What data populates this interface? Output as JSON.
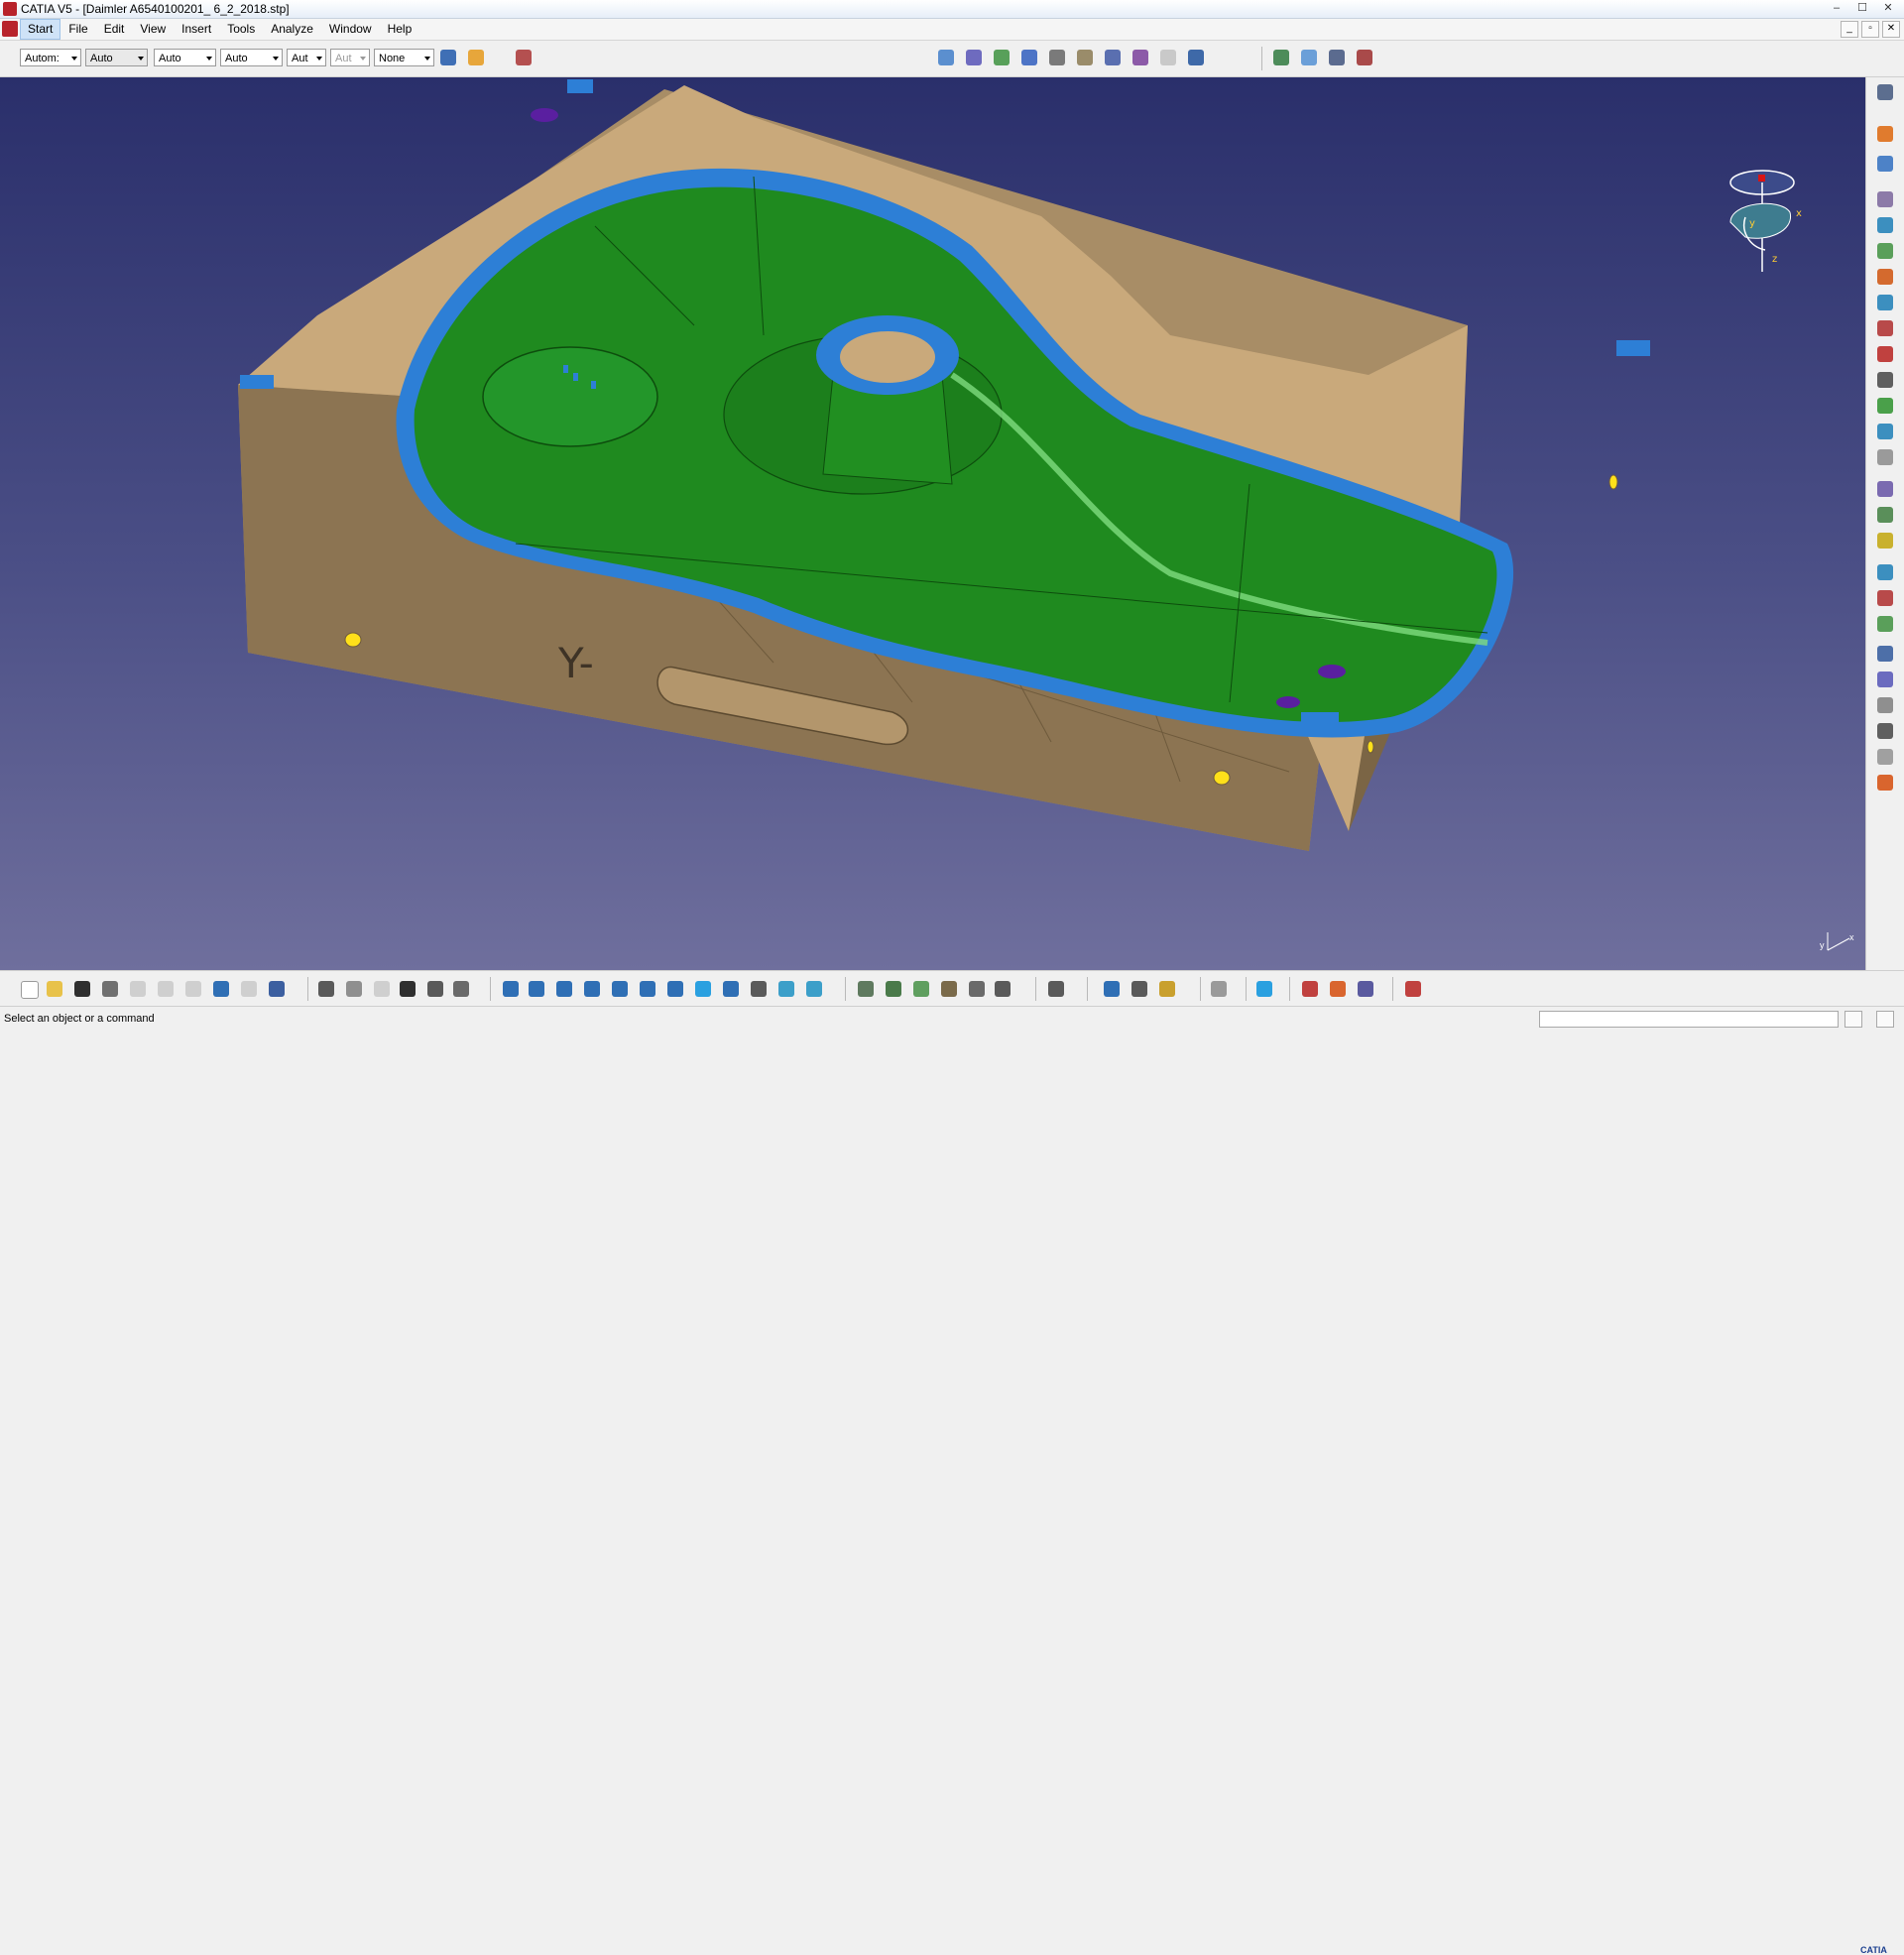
{
  "window": {
    "title": "CATIA V5 - [Daimler A6540100201_ 6_2_2018.stp]",
    "controls": [
      "–",
      "☐",
      "✕"
    ]
  },
  "menubar": {
    "items": [
      "Start",
      "File",
      "Edit",
      "View",
      "Insert",
      "Tools",
      "Analyze",
      "Window",
      "Help"
    ],
    "active": "Start",
    "mdi_controls": [
      "_",
      "▫",
      "✕"
    ]
  },
  "toolbar_top": {
    "dropdowns": [
      "Autom:",
      "Auto",
      "Auto",
      "Auto",
      "Aut",
      "Aut",
      "None"
    ],
    "disabled_dropdown_index": 5
  },
  "viewport": {
    "part_label": "Y-",
    "compass_axes": {
      "x": "x",
      "y": "y",
      "z": "z"
    },
    "corner_axes": {
      "x": "x",
      "y": "y"
    },
    "colors": {
      "background_top": "#2a2f6b",
      "background_bottom": "#6f6f9d",
      "body": "#c9a97b",
      "body_side": "#a88d66",
      "cavity": "#1f8a1f",
      "edge_strip": "#2d7fd6",
      "hole_marker": "#5a1fa0",
      "dowel_marker": "#ffe01a"
    }
  },
  "brand": {
    "logo": "CATIA"
  },
  "statusbar": {
    "message": "Select an object or a command"
  },
  "icons": {
    "top_toolbar": [
      "draw-style-icon",
      "paint-icon",
      "catalog-icon",
      "open-body-icon",
      "part-body-icon",
      "assembly-icon",
      "plane-icon",
      "constraint-icon",
      "sketch-icon",
      "feature-icon",
      "tree-icon",
      "update-icon",
      "analysis-icon",
      "view-icon",
      "render-icon",
      "layer-icon",
      "properties-icon"
    ],
    "right_toolbar": [
      "select-icon",
      "pointer-icon",
      "sketcher-icon",
      "pad-icon",
      "pocket-icon",
      "shaft-icon",
      "hole-icon",
      "rib-icon",
      "slot-icon",
      "fillet-icon",
      "chamfer-icon",
      "draft-icon",
      "shell-icon",
      "thickness-icon",
      "thread-icon",
      "mirror-icon",
      "pattern-icon",
      "scale-icon",
      "boolean-icon",
      "split-icon",
      "sew-icon",
      "measure-icon",
      "annotation-icon",
      "text-icon",
      "dimension-icon",
      "apply-material-icon"
    ],
    "bottom_toolbar": [
      "new-icon",
      "open-icon",
      "save-icon",
      "print-icon",
      "cut-icon",
      "copy-icon",
      "paste-icon",
      "undo-icon",
      "redo-icon",
      "whats-this-icon",
      "formula-icon",
      "comment-icon",
      "knowledge-icon",
      "table-icon",
      "macro-icon",
      "tools-icon",
      "fly-icon",
      "fit-all-icon",
      "pan-icon",
      "rotate-icon",
      "zoom-in-icon",
      "zoom-out-icon",
      "normal-view-icon",
      "multi-view-icon",
      "iso-view-icon",
      "shading-icon",
      "hide-show-icon",
      "swap-icon",
      "axis-icon",
      "wire-icon",
      "surface-icon",
      "point-icon",
      "curve-icon",
      "plane-tool-icon",
      "measure-between-icon",
      "inertia-icon",
      "scan-icon",
      "nav-icon",
      "refresh-icon",
      "snap-icon",
      "catalog-browser-icon",
      "stop-icon",
      "grid-icon"
    ]
  }
}
